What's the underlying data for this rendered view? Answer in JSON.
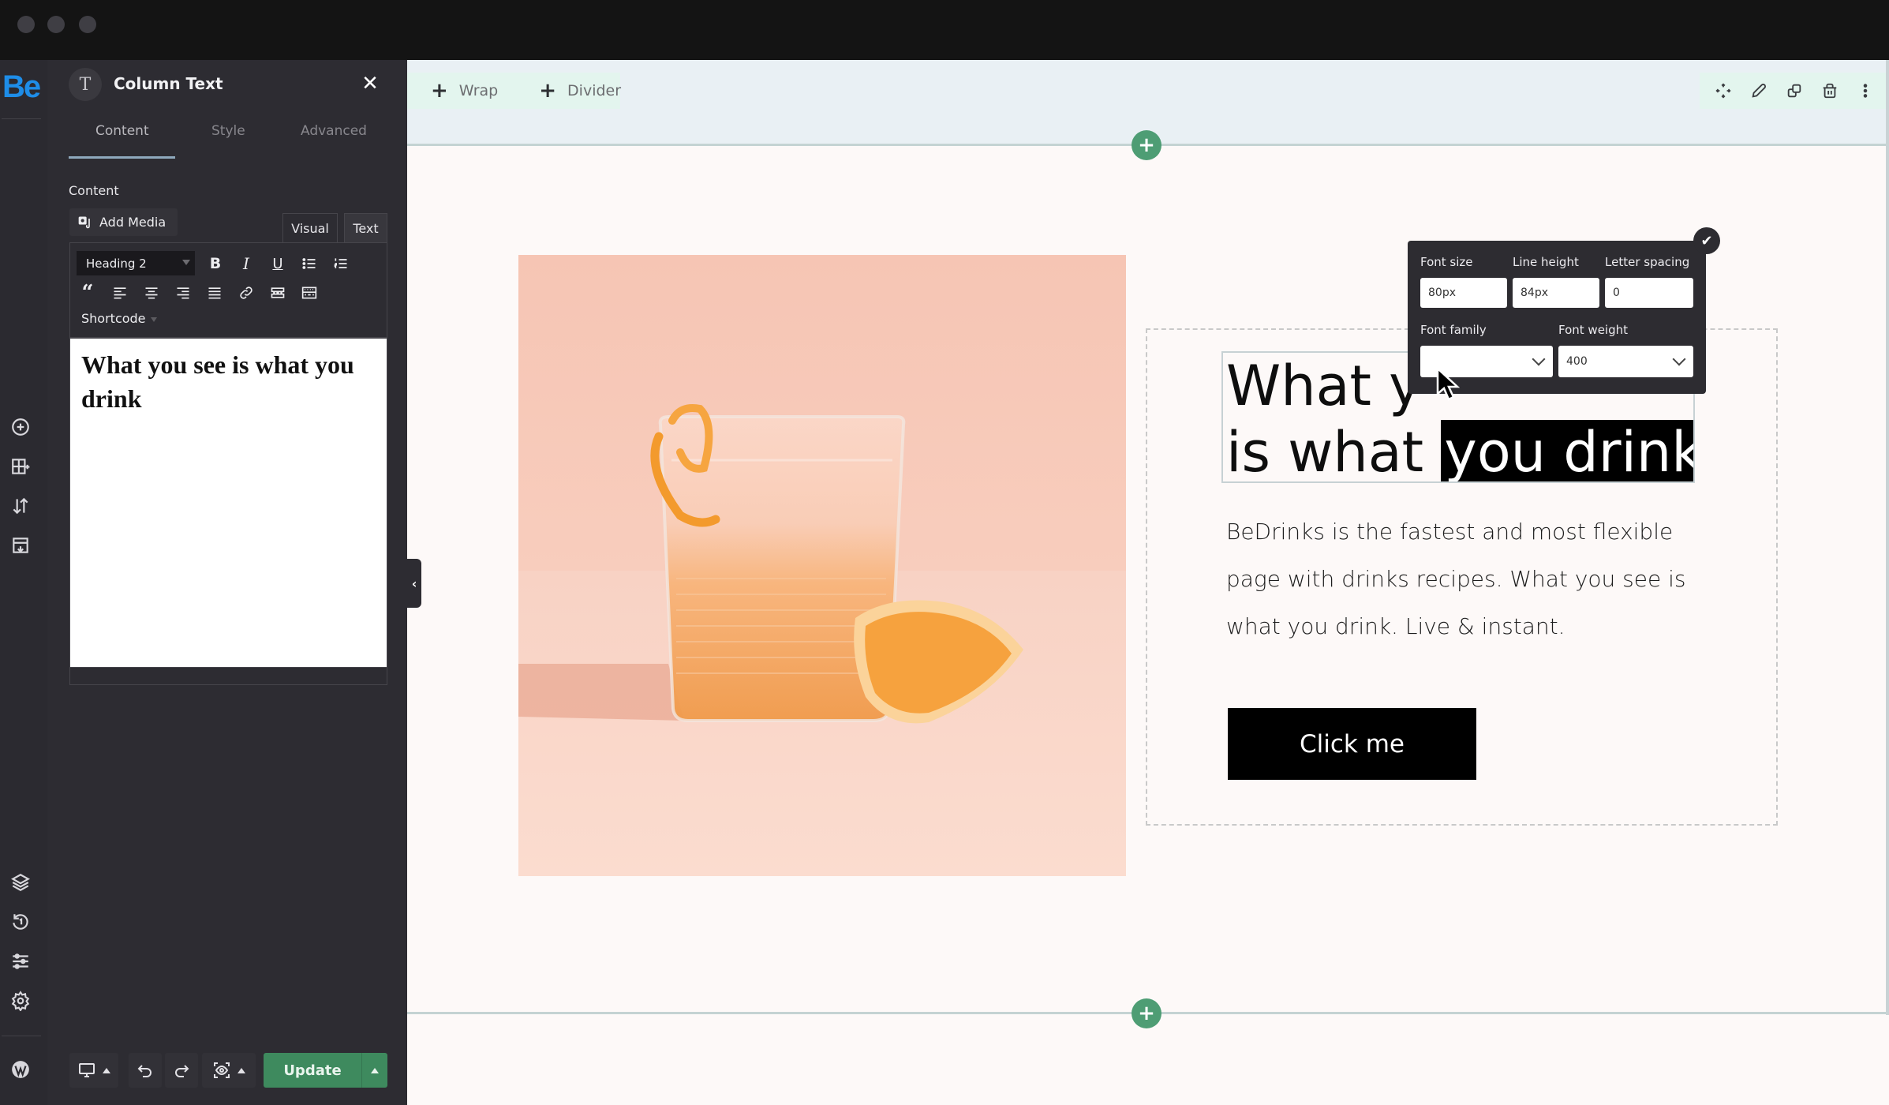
{
  "window": {
    "traffic_lights": [
      "close",
      "minimize",
      "maximize"
    ]
  },
  "rail": {
    "logo": "Be",
    "top_icons": [
      "add-element-icon",
      "add-section-icon",
      "sort-icon",
      "template-icon"
    ],
    "bottom_icons": [
      "layers-icon",
      "history-icon",
      "sliders-icon",
      "settings-icon"
    ],
    "footer_icon": "wordpress-icon"
  },
  "panel": {
    "avatar_glyph": "T",
    "title": "Column Text",
    "close_glyph": "✕",
    "tabs": [
      {
        "label": "Content",
        "active": true
      },
      {
        "label": "Style",
        "active": false
      },
      {
        "label": "Advanced",
        "active": false
      }
    ],
    "section_label": "Content",
    "add_media_label": "Add Media",
    "editor_modes": {
      "visual": "Visual",
      "text": "Text"
    },
    "format_select": "Heading 2",
    "shortcode_label": "Shortcode",
    "toolbar_row1": [
      "bold",
      "italic",
      "underline",
      "bullet-list",
      "numbered-list"
    ],
    "toolbar_row2": [
      "blockquote",
      "align-left",
      "align-center",
      "align-right",
      "justify",
      "link",
      "read-more",
      "keyboard"
    ],
    "editor_content": "What you see is what you drink",
    "collapse_glyph": "‹",
    "bottom": {
      "device": "desktop",
      "update_label": "Update"
    }
  },
  "canvas": {
    "section_toolbar": {
      "items": [
        {
          "icon": "+",
          "label": "Wrap"
        },
        {
          "icon": "+",
          "label": "Divider"
        }
      ],
      "actions": [
        "move-icon",
        "edit-icon",
        "duplicate-icon",
        "delete-icon",
        "more-icon"
      ]
    },
    "add_section_glyph": "+",
    "photo_alt": "Orange drink in glass with orange slice",
    "heading": {
      "line1": "What y",
      "line2_plain": "is what ",
      "line2_selected": "you drink"
    },
    "body_text": "BeDrinks is the fastest and most flexible page with drinks recipes. What you see is what you drink. Live & instant.",
    "cta_label": "Click me",
    "typography_popup": {
      "font_size_label": "Font size",
      "font_size_value": "80px",
      "line_height_label": "Line height",
      "line_height_value": "84px",
      "letter_spacing_label": "Letter spacing",
      "letter_spacing_value": "0",
      "font_family_label": "Font family",
      "font_family_value": "",
      "font_weight_label": "Font weight",
      "font_weight_value": "400",
      "confirm_glyph": "✔"
    }
  },
  "colors": {
    "brand_blue": "#1e8de8",
    "update_green": "#3e8a5e",
    "add_circle_green": "#4e9d74",
    "panel_bg": "#2d2c32",
    "canvas_bg": "#fdf9f8"
  }
}
